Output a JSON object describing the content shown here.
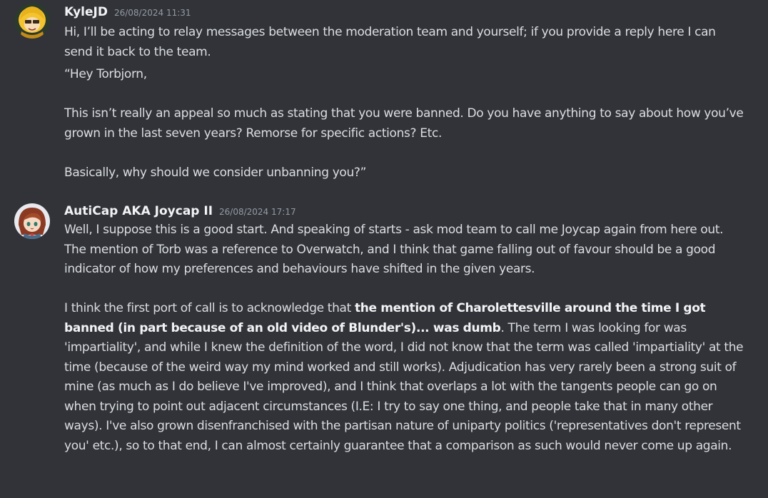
{
  "messages": [
    {
      "username": "KyleJD",
      "timestamp": "26/08/2024 11:31",
      "avatar_icon": "yellow-haired-character-avatar-icon",
      "paragraphs": [
        "Hi, I’ll be acting to relay messages between the moderation team and yourself; if you provide a reply here I can send it back to the team.",
        "“Hey Torbjorn,",
        "This isn’t really an appeal so much as stating that you were banned. Do you have anything to say about how you’ve grown in the last seven years? Remorse for specific actions? Etc.",
        "Basically, why should we consider unbanning you?”"
      ]
    },
    {
      "username": "AutiCap AKA Joycap II",
      "timestamp": "26/08/2024 17:17",
      "avatar_icon": "brown-haired-character-avatar-icon",
      "paragraphs": [
        "Well, I suppose this is a good start. And speaking of starts - ask mod team to call me Joycap again from here out. The mention of Torb was a reference to Overwatch, and I think that game falling out of favour should be a good indicator of how my preferences and behaviours have shifted in the given years."
      ],
      "para2_before": "I think the first port of call is to acknowledge that ",
      "para2_bold": "the mention of Charolettesville around the time I got banned (in part because of an old video of Blunder's)... was dumb",
      "para2_after": ". The term I was looking for was 'impartiality', and while I knew the definition of the word, I did not know that the term was called 'impartiality' at the time (because of the weird way my mind worked and still works). Adjudication has very rarely been a strong suit of mine (as much as I do believe I've improved), and I think that overlaps a lot with the tangents people can go on when trying to point out adjacent circumstances (I.E: I try to say one thing, and people take that in many other ways). I've also grown disenfranchised with the partisan nature of uniparty politics ('representatives don't represent you' etc.), so to that end, I can almost certainly guarantee that a comparison as such would never come up again."
    }
  ],
  "colors": {
    "background": "#313338",
    "text": "#dbdee1",
    "username": "#f2f3f5",
    "timestamp": "#949ba4"
  }
}
